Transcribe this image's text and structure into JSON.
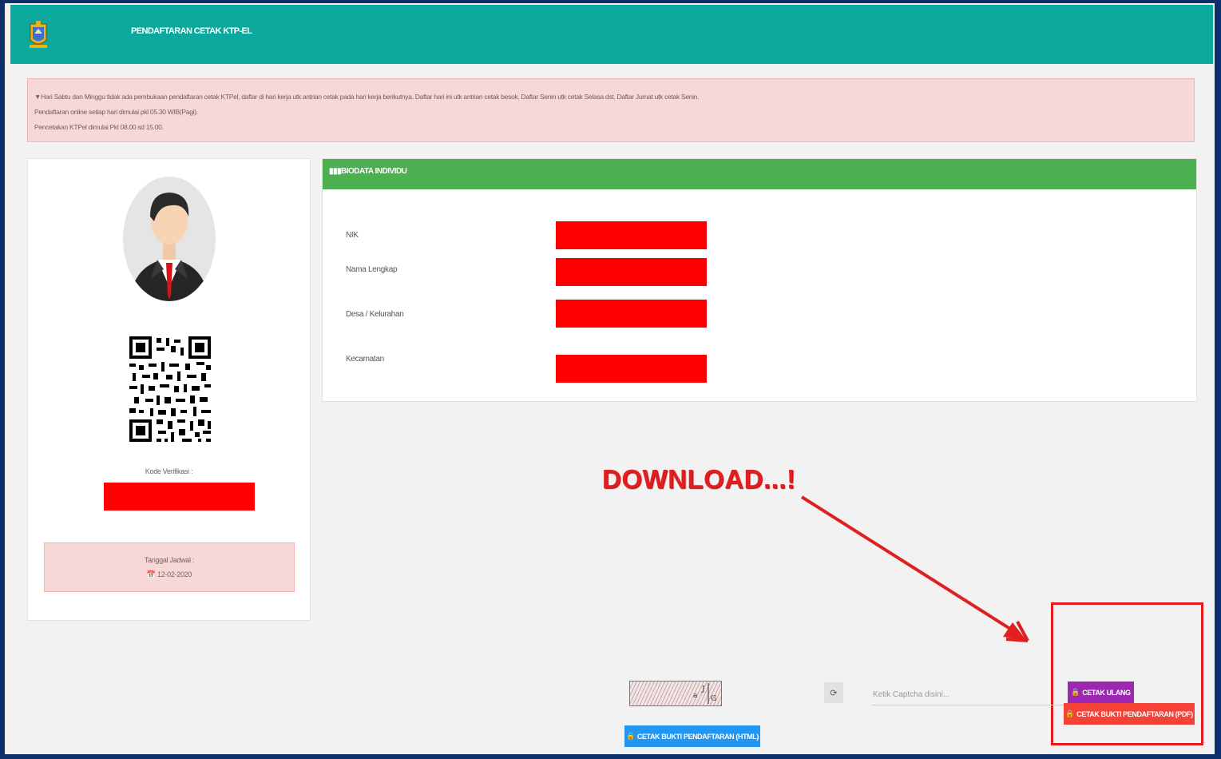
{
  "header": {
    "title": "PENDAFTARAN CETAK KTP-EL"
  },
  "alert": {
    "line1": "Hari Sabtu dan Minggu tidak ada pembukaan pendaftaran cetak KTPel, daftar di hari kerja utk antrian cetak pada hari kerja berikutnya. Daftar hari ini utk antrian cetak besok, Daftar Senin utk cetak Selasa dst, Daftar Jumat utk cetak Senin.",
    "line2": "Pendaftaran online setiap hari dimulai pkl 05.30 WIB(Pagi).",
    "line3": "Pencetakan KTPel dimulai Pkl 08.00 sd 15.00."
  },
  "left_card": {
    "kode_label": "Kode Verifikasi :",
    "jadwal_label": "Tanggal Jadwal :",
    "jadwal_date": "12-02-2020"
  },
  "biodata": {
    "header": "BIODATA INDIVIDU",
    "fields": [
      {
        "label": "NIK"
      },
      {
        "label": "Nama Lengkap"
      },
      {
        "label": "Desa / Kelurahan"
      },
      {
        "label": "Kecamatan"
      }
    ]
  },
  "annotation": {
    "text": "DOWNLOAD...!",
    "color": "#e02020"
  },
  "captcha": {
    "placeholder": "Ketik Captcha disini...",
    "refresh_icon": "refresh-icon"
  },
  "buttons": {
    "cetak_ulang": "CETAK ULANG",
    "cetak_pdf": "CETAK BUKTI PENDAFTARAN (PDF)",
    "cetak_html": "CETAK BUKTI PENDAFTARAN (HTML)"
  },
  "colors": {
    "header": "#0aa89d",
    "biodata_header": "#4caf50",
    "alert_bg": "#f8d7d7",
    "btn_ulang": "#9c27b0",
    "btn_pdf": "#f44336",
    "btn_html": "#2196f3",
    "redaction": "#ff0000"
  }
}
